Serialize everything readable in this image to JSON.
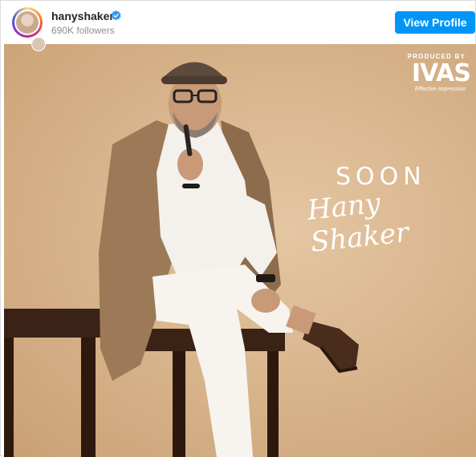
{
  "header": {
    "username": "hanyshaker",
    "followers": "690K followers",
    "view_profile_label": "View Profile"
  },
  "post": {
    "produced_by": "PRODUCED BY",
    "logo_text": "IVAS",
    "logo_tagline": "Effective Impression",
    "soon_text": "SOON",
    "signature_text": "Hany Shaker"
  },
  "colors": {
    "accent": "#0095f6",
    "verified": "#3897f0",
    "background": "#d9b68e"
  }
}
